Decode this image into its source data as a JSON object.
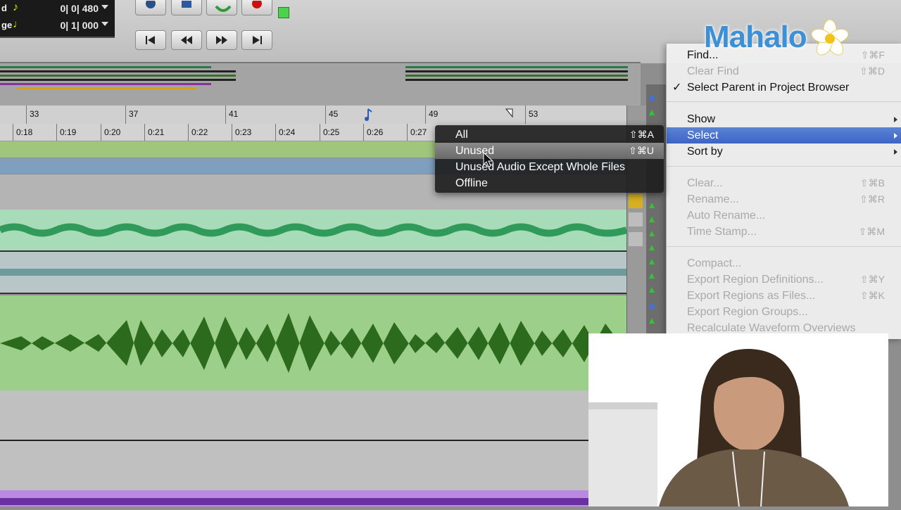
{
  "counter": {
    "row1": {
      "label": "d",
      "value": "0| 0| 480"
    },
    "row2": {
      "label": "ge",
      "value": "0| 1| 000"
    }
  },
  "bars_ruler": [
    "33",
    "37",
    "41",
    "45",
    "49",
    "53"
  ],
  "min_secs_ruler": [
    "0:18",
    "0:19",
    "0:20",
    "0:21",
    "0:22",
    "0:23",
    "0:24",
    "0:25",
    "0:26",
    "0:27"
  ],
  "region_menu": {
    "items": [
      {
        "label": "Find...",
        "shortcut": "⇧⌘F",
        "enabled": true
      },
      {
        "label": "Clear Find",
        "shortcut": "⇧⌘D",
        "enabled": false
      },
      {
        "label": "Select Parent in Project Browser",
        "shortcut": "",
        "enabled": true,
        "checked": true
      },
      {
        "label": "Show",
        "shortcut": "",
        "enabled": true,
        "submenu": true
      },
      {
        "label": "Select",
        "shortcut": "",
        "enabled": true,
        "submenu": true,
        "highlighted": true
      },
      {
        "label": "Sort by",
        "shortcut": "",
        "enabled": true,
        "submenu": true
      },
      {
        "label": "Clear...",
        "shortcut": "⇧⌘B",
        "enabled": false
      },
      {
        "label": "Rename...",
        "shortcut": "⇧⌘R",
        "enabled": false
      },
      {
        "label": "Auto Rename...",
        "shortcut": "",
        "enabled": false
      },
      {
        "label": "Time Stamp...",
        "shortcut": "⇧⌘M",
        "enabled": false
      },
      {
        "label": "Compact...",
        "shortcut": "",
        "enabled": false
      },
      {
        "label": "Export Region Definitions...",
        "shortcut": "⇧⌘Y",
        "enabled": false
      },
      {
        "label": "Export Regions as Files...",
        "shortcut": "⇧⌘K",
        "enabled": false
      },
      {
        "label": "Export Region Groups...",
        "shortcut": "",
        "enabled": false
      },
      {
        "label": "Recalculate Waveform Overviews",
        "shortcut": "",
        "enabled": false
      }
    ]
  },
  "select_submenu": {
    "items": [
      {
        "label": "All",
        "shortcut": "⇧⌘A"
      },
      {
        "label": "Unused",
        "shortcut": "⇧⌘U",
        "highlighted": true
      },
      {
        "label": "Unused Audio Except Whole Files",
        "shortcut": ""
      },
      {
        "label": "Offline",
        "shortcut": ""
      }
    ]
  },
  "watermark": "Mahalo",
  "colors": {
    "track_green": "#9fc67c",
    "track_blue": "#7f9fbf",
    "waveform_mint": "#a8dcb8",
    "waveform_green": "#9ccf8a",
    "waveform_dark": "#2c6a1d",
    "waveform_purple": "#8a4fc2",
    "menu_highlight": "#4a70cc"
  }
}
